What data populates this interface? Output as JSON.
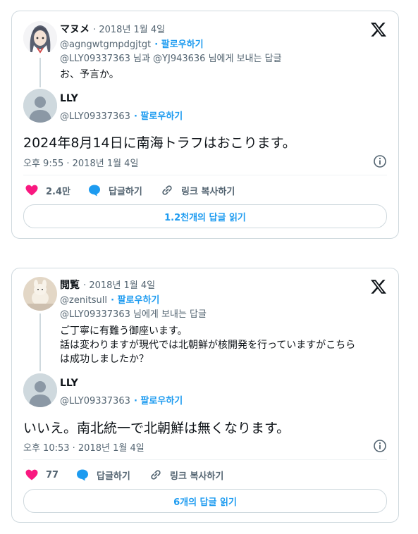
{
  "colors": {
    "accent": "#1d9bf0",
    "like": "#f91880",
    "muted": "#536471",
    "border": "#cfd9de"
  },
  "tweets": [
    {
      "parent": {
        "name": "マヌメ",
        "date": "· 2018년 1월 4일",
        "handle": "@agngwtgmpdgjtgt",
        "follow": "· 팔로우하기",
        "reply_to": "@LLY09337363 님과 @YJ943636 님에게 보내는 답글",
        "text": [
          "お、予言か。"
        ]
      },
      "main": {
        "name": "LLY",
        "handle": "@LLY09337363",
        "follow": "· 팔로우하기",
        "text": "2024年8月14日に南海トラフはおこります。",
        "timestamp": "오후 9:55 · 2018년 1월 4일"
      },
      "actions": {
        "likes": "2.4만",
        "reply": "답글하기",
        "copy": "링크 복사하기"
      },
      "read_button": "1.2천개의 답글 읽기"
    },
    {
      "parent": {
        "name": "閲覧",
        "date": "· 2018년 1월 4일",
        "handle": "@zenitsull",
        "follow": "· 팔로우하기",
        "reply_to": "@LLY09337363 님에게 보내는 답글",
        "text": [
          "ご丁寧に有難う御座います。",
          "話は変わりますが現代では北朝鮮が核開発を行っていますがこちら",
          "は成功しましたか？"
        ]
      },
      "main": {
        "name": "LLY",
        "handle": "@LLY09337363",
        "follow": "· 팔로우하기",
        "text": "いいえ。南北統一で北朝鮮は無くなります。",
        "timestamp": "오후 10:53 · 2018년 1월 4일"
      },
      "actions": {
        "likes": "77",
        "reply": "답글하기",
        "copy": "링크 복사하기"
      },
      "read_button": "6개의 답글 읽기"
    }
  ]
}
